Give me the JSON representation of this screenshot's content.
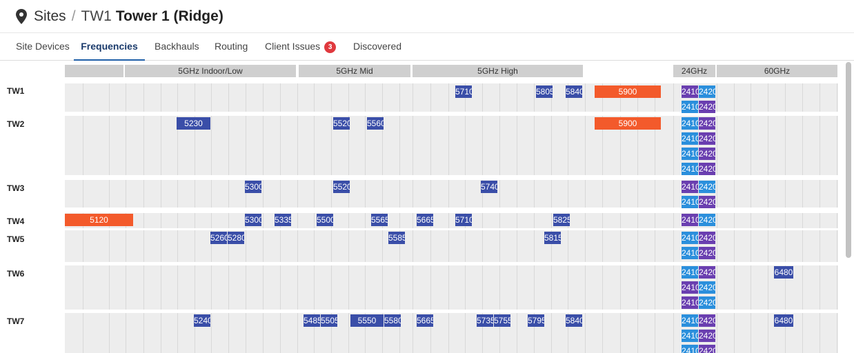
{
  "header": {
    "breadcrumb_root": "Sites",
    "separator": "/",
    "site_code": "TW1",
    "site_name": "Tower 1 (Ridge)"
  },
  "tabs": [
    {
      "label": "Site Devices"
    },
    {
      "label": "Frequencies",
      "active": true
    },
    {
      "label": "Backhauls"
    },
    {
      "label": "Routing"
    },
    {
      "label": "Client Issues",
      "badge": "3"
    },
    {
      "label": "Discovered"
    }
  ],
  "bands": [
    "5GHz Indoor/Low",
    "5GHz Mid",
    "5GHz High",
    "24GHz",
    "60GHz"
  ],
  "colors": {
    "channel": "#3a4ea8",
    "wide_channel": "#f35a2b",
    "ghz24_a": "#6a3fb0",
    "ghz24_b": "#2b8fdc"
  },
  "rows": [
    {
      "label": "TW1",
      "chips": [
        {
          "text": "5710",
          "color": "blue"
        },
        {
          "text": "5805",
          "color": "blue"
        },
        {
          "text": "5840",
          "color": "blue"
        },
        {
          "text": "5900",
          "color": "orange"
        },
        {
          "text": "2410",
          "color": "purple"
        },
        {
          "text": "2420",
          "color": "sky"
        },
        {
          "text": "2410",
          "color": "sky"
        },
        {
          "text": "2420",
          "color": "purple"
        }
      ]
    },
    {
      "label": "TW2",
      "chips": [
        {
          "text": "5230",
          "color": "blue"
        },
        {
          "text": "5520",
          "color": "blue"
        },
        {
          "text": "5560",
          "color": "blue"
        },
        {
          "text": "5900",
          "color": "orange"
        },
        {
          "text": "2410",
          "color": "sky"
        },
        {
          "text": "2420",
          "color": "purple"
        },
        {
          "text": "2410",
          "color": "sky"
        },
        {
          "text": "2420",
          "color": "purple"
        },
        {
          "text": "2410",
          "color": "sky"
        },
        {
          "text": "2420",
          "color": "purple"
        },
        {
          "text": "2410",
          "color": "sky"
        },
        {
          "text": "2420",
          "color": "purple"
        }
      ]
    },
    {
      "label": "TW3",
      "chips": [
        {
          "text": "5300",
          "color": "blue"
        },
        {
          "text": "5520",
          "color": "blue"
        },
        {
          "text": "5740",
          "color": "blue"
        },
        {
          "text": "2410",
          "color": "purple"
        },
        {
          "text": "2420",
          "color": "sky"
        },
        {
          "text": "2410",
          "color": "sky"
        },
        {
          "text": "2420",
          "color": "purple"
        }
      ]
    },
    {
      "label": "TW4",
      "chips": [
        {
          "text": "5120",
          "color": "orange"
        },
        {
          "text": "5300",
          "color": "blue"
        },
        {
          "text": "5335",
          "color": "blue"
        },
        {
          "text": "5500",
          "color": "blue"
        },
        {
          "text": "5565",
          "color": "blue"
        },
        {
          "text": "5665",
          "color": "blue"
        },
        {
          "text": "5710",
          "color": "blue"
        },
        {
          "text": "5825",
          "color": "blue"
        },
        {
          "text": "2410",
          "color": "purple"
        },
        {
          "text": "2420",
          "color": "sky"
        }
      ]
    },
    {
      "label": "TW5",
      "chips": [
        {
          "text": "5260",
          "color": "blue"
        },
        {
          "text": "5280",
          "color": "blue"
        },
        {
          "text": "5585",
          "color": "blue"
        },
        {
          "text": "5815",
          "color": "blue"
        },
        {
          "text": "2410",
          "color": "sky"
        },
        {
          "text": "2420",
          "color": "purple"
        },
        {
          "text": "2410",
          "color": "sky"
        },
        {
          "text": "2420",
          "color": "purple"
        }
      ]
    },
    {
      "label": "TW6",
      "chips": [
        {
          "text": "2410",
          "color": "sky"
        },
        {
          "text": "2420",
          "color": "purple"
        },
        {
          "text": "2410",
          "color": "purple"
        },
        {
          "text": "2420",
          "color": "sky"
        },
        {
          "text": "2410",
          "color": "purple"
        },
        {
          "text": "2420",
          "color": "sky"
        },
        {
          "text": "6480",
          "color": "blue"
        }
      ]
    },
    {
      "label": "TW7",
      "chips": [
        {
          "text": "5240",
          "color": "blue"
        },
        {
          "text": "5485",
          "color": "blue"
        },
        {
          "text": "5505",
          "color": "blue"
        },
        {
          "text": "5550",
          "color": "blue"
        },
        {
          "text": "5580",
          "color": "blue"
        },
        {
          "text": "5665",
          "color": "blue"
        },
        {
          "text": "5735",
          "color": "blue"
        },
        {
          "text": "5755",
          "color": "blue"
        },
        {
          "text": "5795",
          "color": "blue"
        },
        {
          "text": "5840",
          "color": "blue"
        },
        {
          "text": "2410",
          "color": "sky"
        },
        {
          "text": "2420",
          "color": "purple"
        },
        {
          "text": "2410",
          "color": "sky"
        },
        {
          "text": "2420",
          "color": "purple"
        },
        {
          "text": "2410",
          "color": "sky"
        },
        {
          "text": "2420",
          "color": "purple"
        },
        {
          "text": "6480",
          "color": "blue"
        }
      ]
    }
  ]
}
